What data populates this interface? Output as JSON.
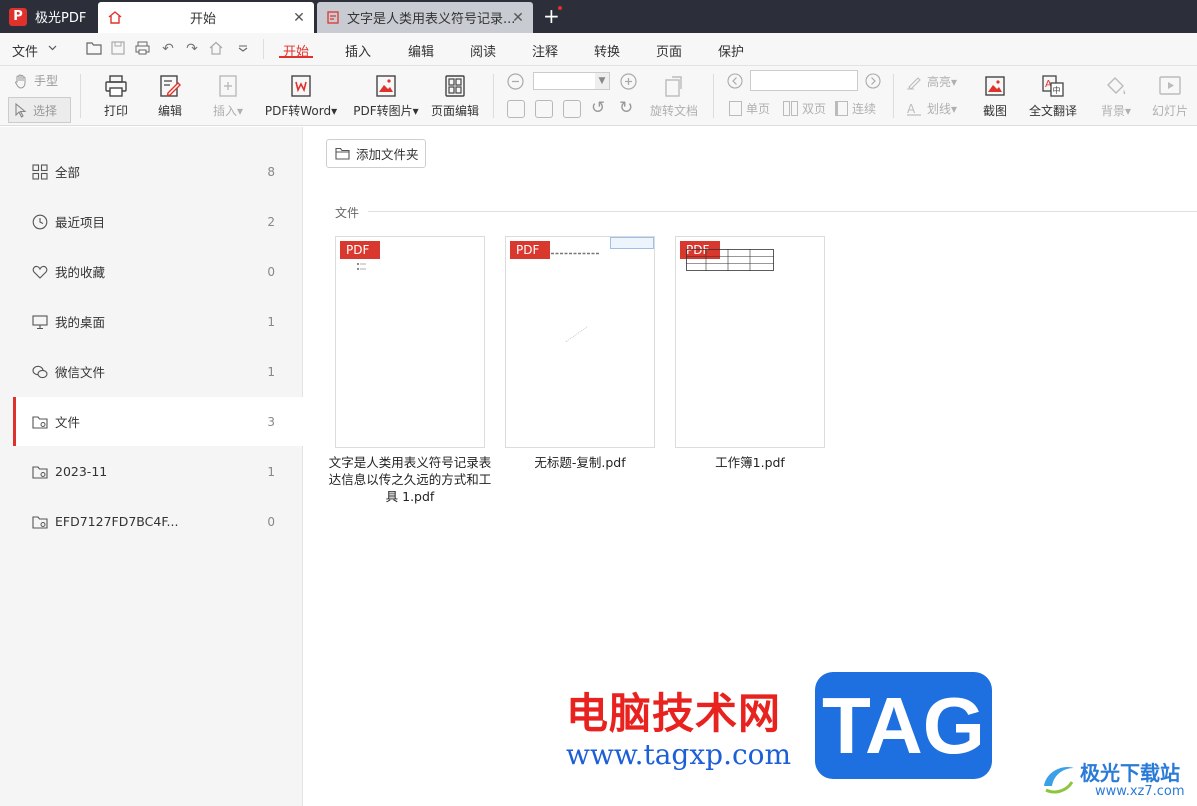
{
  "app": {
    "name": "极光PDF",
    "logo_letter": "P"
  },
  "tabs": [
    {
      "label": "开始",
      "close": "✕"
    },
    {
      "label": "文字是人类用表义符号记录...",
      "close": "✕"
    }
  ],
  "newtab": "+",
  "menu": {
    "file": "文件",
    "items": [
      "开始",
      "插入",
      "编辑",
      "阅读",
      "注释",
      "转换",
      "页面",
      "保护"
    ]
  },
  "toolbar": {
    "hand": "手型",
    "select": "选择",
    "print": "打印",
    "edit": "编辑",
    "insert": "插入▾",
    "to_word": "PDF转Word▾",
    "to_image": "PDF转图片▾",
    "page_edit": "页面编辑",
    "rotate_doc": "旋转文档",
    "single": "单页",
    "double": "双页",
    "continuous": "连续",
    "highlight": "高亮▾",
    "strikeout": "划线▾",
    "screenshot": "截图",
    "translate": "全文翻译",
    "background": "背景▾",
    "slideshow": "幻灯片"
  },
  "sidebar": {
    "items": [
      {
        "label": "全部",
        "count": "8",
        "icon": "grid-icon"
      },
      {
        "label": "最近项目",
        "count": "2",
        "icon": "clock-icon"
      },
      {
        "label": "我的收藏",
        "count": "0",
        "icon": "heart-icon"
      },
      {
        "label": "我的桌面",
        "count": "1",
        "icon": "monitor-icon"
      },
      {
        "label": "微信文件",
        "count": "1",
        "icon": "wechat-icon"
      },
      {
        "label": "文件",
        "count": "3",
        "icon": "folder-icon"
      },
      {
        "label": "2023-11",
        "count": "1",
        "icon": "folder-icon"
      },
      {
        "label": "EFD7127FD7BC4F...",
        "count": "0",
        "icon": "folder-icon"
      }
    ]
  },
  "main": {
    "add_folder": "添加文件夹",
    "section": "文件",
    "files": [
      {
        "badge": "PDF",
        "name": "文字是人类用表义符号记录表达信息以传之久远的方式和工具 1.pdf"
      },
      {
        "badge": "PDF",
        "name": "无标题-复制.pdf"
      },
      {
        "badge": "PDF",
        "name": "工作簿1.pdf"
      }
    ]
  },
  "watermark": {
    "text": "电脑技术网",
    "url": "www.tagxp.com",
    "tag": "TAG",
    "site_name": "极光下载站",
    "site_url": "www.xz7.com"
  },
  "colors": {
    "accent": "#e0322c",
    "titlebar": "#2c2f3a"
  }
}
